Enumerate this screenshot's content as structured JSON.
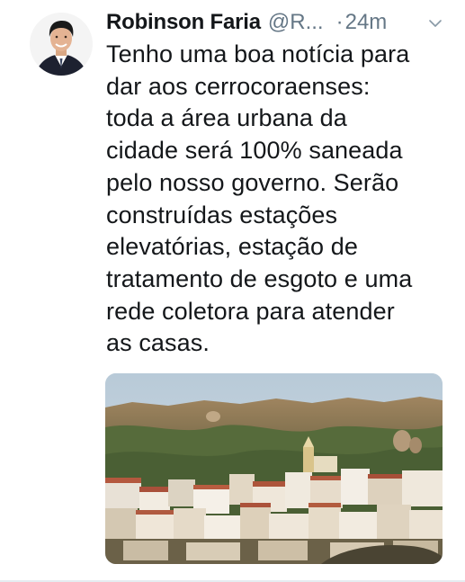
{
  "tweet": {
    "author_name": "Robinson Faria",
    "handle": "@R...",
    "separator": "·",
    "time": "24m",
    "text": "Tenho uma boa notícia para\ndar aos cerrocoraenses:\ntoda a área urbana da\ncidade será 100% saneada\npelo nosso governo. Serão\nconstruídas estações\nelevatórias, estação de\ntratamento de esgoto e uma\nrede coletora para atender\nas casas.",
    "menu_icon": "chevron-down-icon"
  },
  "colors": {
    "text": "#14171a",
    "secondary": "#657786",
    "divider": "#e6ecf0"
  }
}
